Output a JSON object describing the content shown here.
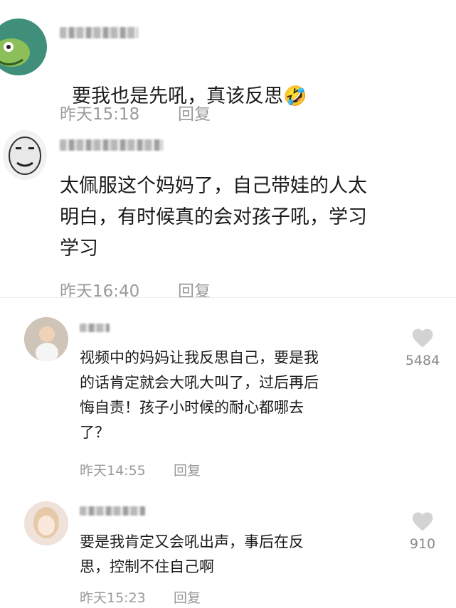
{
  "comments": [
    {
      "text": "要我也是先吼，真该反思",
      "emoji": "🤣",
      "time": "昨天15:18",
      "reply": "回复"
    },
    {
      "text": "太佩服这个妈妈了，自己带娃的人太\n明白，有时候真的会对孩子吼，学习\n学习",
      "time": "昨天16:40",
      "reply": "回复"
    },
    {
      "text": "视频中的妈妈让我反思自己，要是我\n的话肯定就会大吼大叫了，过后再后\n悔自责！孩子小时候的耐心都哪去\n了？",
      "time": "昨天14:55",
      "reply": "回复",
      "likes": "5484"
    },
    {
      "text": "要是我肯定又会吼出声，事后在反\n思，控制不住自己啊",
      "time": "昨天15:23",
      "reply": "回复",
      "likes": "910"
    }
  ],
  "colors": {
    "meta": "#9a9a9a",
    "like_icon": "#d3d3d3"
  }
}
